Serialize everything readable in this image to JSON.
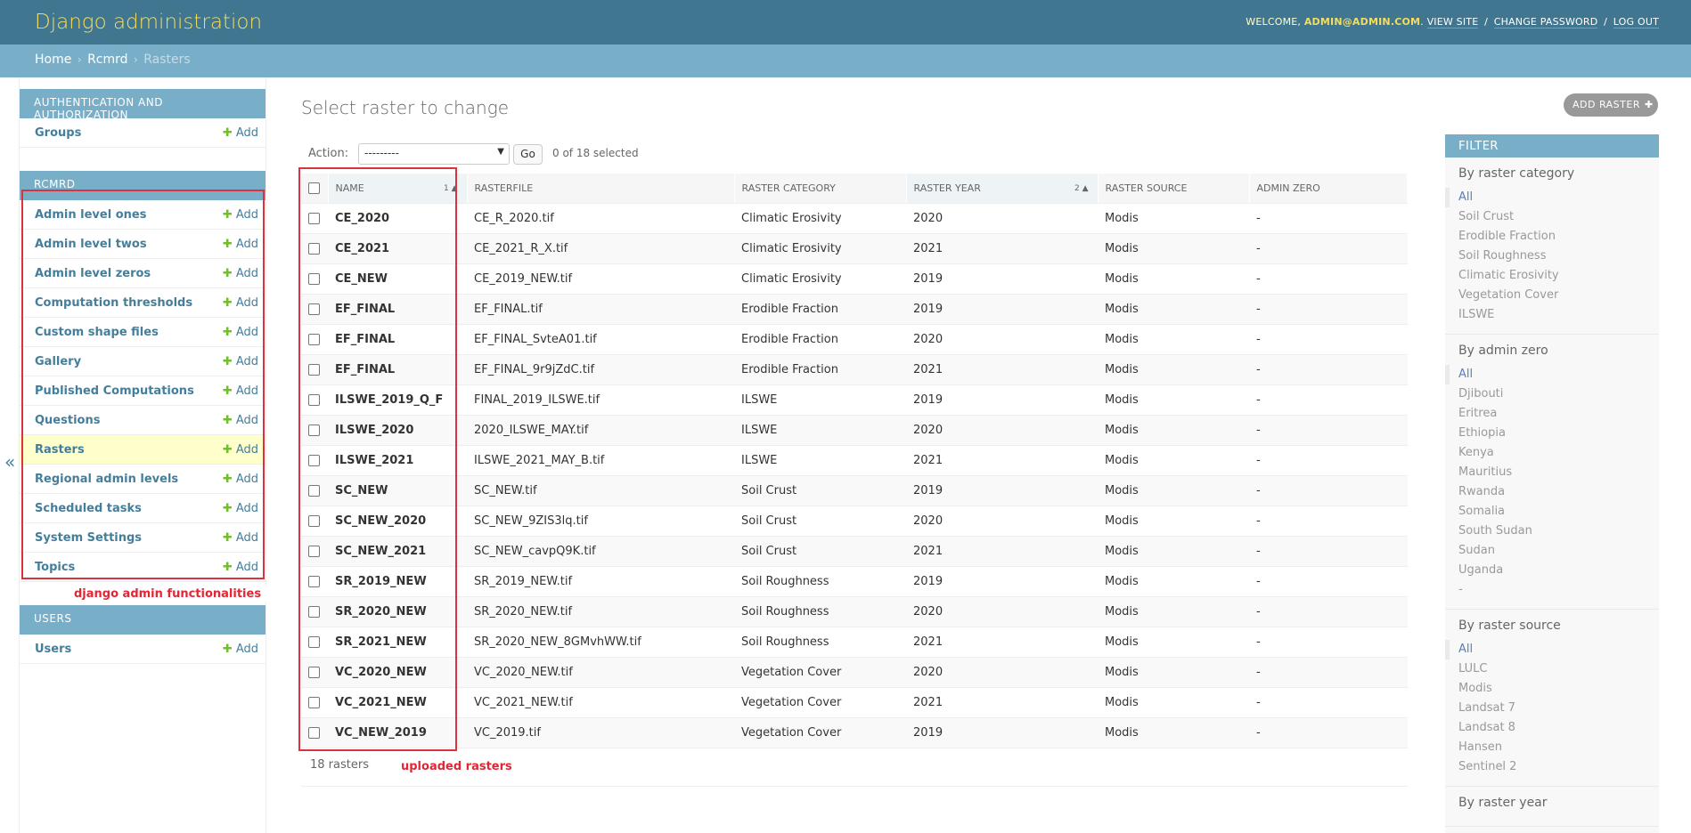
{
  "header": {
    "brand": "Django administration",
    "welcome_prefix": "WELCOME,",
    "user": "ADMIN@ADMIN.COM",
    "view_site": "VIEW SITE",
    "change_password": "CHANGE PASSWORD",
    "log_out": "LOG OUT",
    "separator": "/"
  },
  "breadcrumbs": {
    "home": "Home",
    "app": "Rcmrd",
    "current": "Rasters",
    "arrow": "›"
  },
  "nav_toggle": "«",
  "sidebar": {
    "auth_caption": "AUTHENTICATION AND AUTHORIZATION",
    "auth_models": [
      {
        "name": "Groups",
        "add": "Add"
      }
    ],
    "rcmrd_caption": "RCMRD",
    "rcmrd_models": [
      {
        "name": "Admin level ones",
        "add": "Add"
      },
      {
        "name": "Admin level twos",
        "add": "Add"
      },
      {
        "name": "Admin level zeros",
        "add": "Add"
      },
      {
        "name": "Computation thresholds",
        "add": "Add"
      },
      {
        "name": "Custom shape files",
        "add": "Add"
      },
      {
        "name": "Gallery",
        "add": "Add"
      },
      {
        "name": "Published Computations",
        "add": "Add"
      },
      {
        "name": "Questions",
        "add": "Add"
      },
      {
        "name": "Rasters",
        "add": "Add"
      },
      {
        "name": "Regional admin levels",
        "add": "Add"
      },
      {
        "name": "Scheduled tasks",
        "add": "Add"
      },
      {
        "name": "System Settings",
        "add": "Add"
      },
      {
        "name": "Topics",
        "add": "Add"
      }
    ],
    "users_caption": "USERS",
    "users_models": [
      {
        "name": "Users",
        "add": "Add"
      }
    ]
  },
  "content": {
    "title": "Select raster to change",
    "add_button": "ADD RASTER",
    "action_label": "Action:",
    "action_value": "---------",
    "go": "Go",
    "selected": "0 of 18 selected",
    "columns": {
      "name": "NAME",
      "name_sort": "1",
      "rasterfile": "RASTERFILE",
      "raster_category": "RASTER CATEGORY",
      "raster_year": "RASTER YEAR",
      "year_sort": "2",
      "raster_source": "RASTER SOURCE",
      "admin_zero": "ADMIN ZERO"
    },
    "rows": [
      {
        "name": "CE_2020",
        "file": "CE_R_2020.tif",
        "category": "Climatic Erosivity",
        "year": "2020",
        "source": "Modis",
        "admin_zero": "-"
      },
      {
        "name": "CE_2021",
        "file": "CE_2021_R_X.tif",
        "category": "Climatic Erosivity",
        "year": "2021",
        "source": "Modis",
        "admin_zero": "-"
      },
      {
        "name": "CE_NEW",
        "file": "CE_2019_NEW.tif",
        "category": "Climatic Erosivity",
        "year": "2019",
        "source": "Modis",
        "admin_zero": "-"
      },
      {
        "name": "EF_FINAL",
        "file": "EF_FINAL.tif",
        "category": "Erodible Fraction",
        "year": "2019",
        "source": "Modis",
        "admin_zero": "-"
      },
      {
        "name": "EF_FINAL",
        "file": "EF_FINAL_SvteA01.tif",
        "category": "Erodible Fraction",
        "year": "2020",
        "source": "Modis",
        "admin_zero": "-"
      },
      {
        "name": "EF_FINAL",
        "file": "EF_FINAL_9r9jZdC.tif",
        "category": "Erodible Fraction",
        "year": "2021",
        "source": "Modis",
        "admin_zero": "-"
      },
      {
        "name": "ILSWE_2019_Q_F",
        "file": "FINAL_2019_ILSWE.tif",
        "category": "ILSWE",
        "year": "2019",
        "source": "Modis",
        "admin_zero": "-"
      },
      {
        "name": "ILSWE_2020",
        "file": "2020_ILSWE_MAY.tif",
        "category": "ILSWE",
        "year": "2020",
        "source": "Modis",
        "admin_zero": "-"
      },
      {
        "name": "ILSWE_2021",
        "file": "ILSWE_2021_MAY_B.tif",
        "category": "ILSWE",
        "year": "2021",
        "source": "Modis",
        "admin_zero": "-"
      },
      {
        "name": "SC_NEW",
        "file": "SC_NEW.tif",
        "category": "Soil Crust",
        "year": "2019",
        "source": "Modis",
        "admin_zero": "-"
      },
      {
        "name": "SC_NEW_2020",
        "file": "SC_NEW_9ZIS3lq.tif",
        "category": "Soil Crust",
        "year": "2020",
        "source": "Modis",
        "admin_zero": "-"
      },
      {
        "name": "SC_NEW_2021",
        "file": "SC_NEW_cavpQ9K.tif",
        "category": "Soil Crust",
        "year": "2021",
        "source": "Modis",
        "admin_zero": "-"
      },
      {
        "name": "SR_2019_NEW",
        "file": "SR_2019_NEW.tif",
        "category": "Soil Roughness",
        "year": "2019",
        "source": "Modis",
        "admin_zero": "-"
      },
      {
        "name": "SR_2020_NEW",
        "file": "SR_2020_NEW.tif",
        "category": "Soil Roughness",
        "year": "2020",
        "source": "Modis",
        "admin_zero": "-"
      },
      {
        "name": "SR_2021_NEW",
        "file": "SR_2020_NEW_8GMvhWW.tif",
        "category": "Soil Roughness",
        "year": "2021",
        "source": "Modis",
        "admin_zero": "-"
      },
      {
        "name": "VC_2020_NEW",
        "file": "VC_2020_NEW.tif",
        "category": "Vegetation Cover",
        "year": "2020",
        "source": "Modis",
        "admin_zero": "-"
      },
      {
        "name": "VC_2021_NEW",
        "file": "VC_2021_NEW.tif",
        "category": "Vegetation Cover",
        "year": "2021",
        "source": "Modis",
        "admin_zero": "-"
      },
      {
        "name": "VC_NEW_2019",
        "file": "VC_2019.tif",
        "category": "Vegetation Cover",
        "year": "2019",
        "source": "Modis",
        "admin_zero": "-"
      }
    ],
    "count": "18 rasters"
  },
  "filter": {
    "title": "FILTER",
    "groups": [
      {
        "title": "By raster category",
        "options": [
          "All",
          "Soil Crust",
          "Erodible Fraction",
          "Soil Roughness",
          "Climatic Erosivity",
          "Vegetation Cover",
          "ILSWE"
        ]
      },
      {
        "title": "By admin zero",
        "options": [
          "All",
          "Djibouti",
          "Eritrea",
          "Ethiopia",
          "Kenya",
          "Mauritius",
          "Rwanda",
          "Somalia",
          "South Sudan",
          "Sudan",
          "Uganda",
          "-"
        ]
      },
      {
        "title": "By raster source",
        "options": [
          "All",
          "LULC",
          "Modis",
          "Landsat 7",
          "Landsat 8",
          "Hansen",
          "Sentinel 2"
        ]
      },
      {
        "title": "By raster year",
        "options": []
      }
    ]
  },
  "annotations": {
    "sidebar_label": "django admin functionalities",
    "table_label": "uploaded rasters",
    "color": "#e32636"
  }
}
